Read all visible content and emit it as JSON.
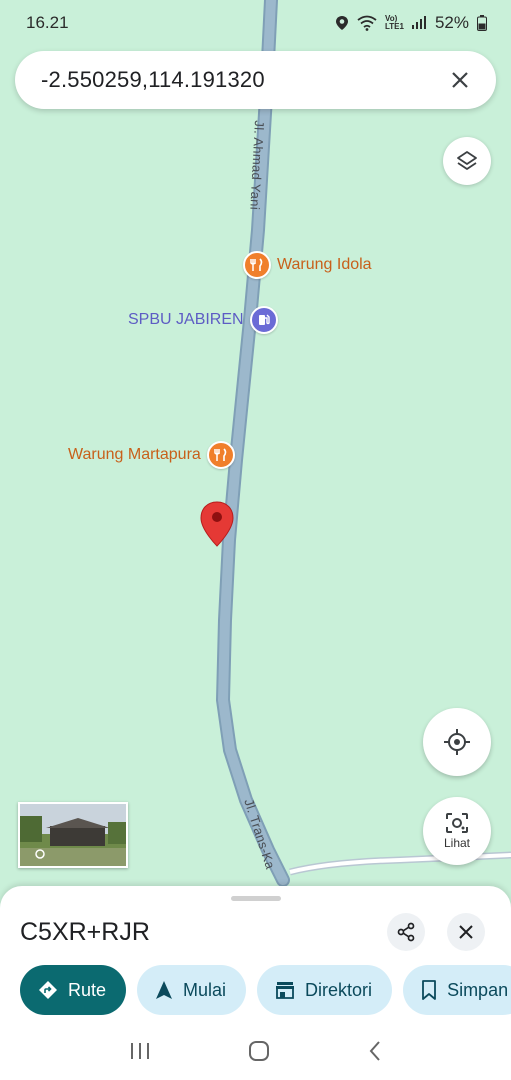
{
  "status_bar": {
    "time": "16.21",
    "network": "Vo) LTE1",
    "battery": "52%"
  },
  "search": {
    "value": "-2.550259,114.191320"
  },
  "map": {
    "pois": [
      {
        "name": "Warung Idola",
        "type": "restaurant"
      },
      {
        "name": "SPBU JABIREN",
        "type": "gas-station"
      },
      {
        "name": "Warung Martapura",
        "type": "restaurant"
      }
    ],
    "roads": [
      {
        "name": "Jl. Ahmad Yani"
      },
      {
        "name": "Jl. Trans-Ka"
      }
    ],
    "pin_color": "#e53935",
    "road_color": "#8faec4"
  },
  "controls": {
    "lihat_label": "Lihat"
  },
  "place": {
    "title": "C5XR+RJR"
  },
  "actions": [
    {
      "label": "Rute",
      "icon": "directions-icon"
    },
    {
      "label": "Mulai",
      "icon": "navigation-arrow-icon"
    },
    {
      "label": "Direktori",
      "icon": "directory-icon"
    },
    {
      "label": "Simpan",
      "icon": "bookmark-icon"
    }
  ],
  "colors": {
    "accent": "#0b6a70",
    "chip_bg": "#d4edf8",
    "map_bg": "#c9f0d9"
  }
}
